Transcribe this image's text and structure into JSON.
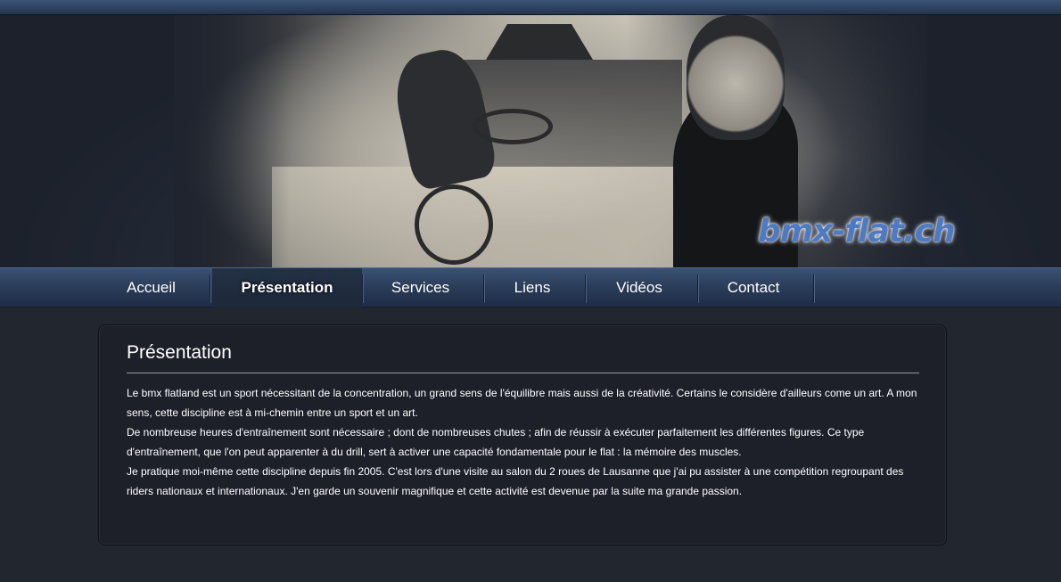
{
  "site": {
    "logo_text": "bmx-flat.ch"
  },
  "nav": {
    "items": [
      {
        "label": "Accueil",
        "active": false
      },
      {
        "label": "Présentation",
        "active": true
      },
      {
        "label": "Services",
        "active": false
      },
      {
        "label": "Liens",
        "active": false
      },
      {
        "label": "Vidéos",
        "active": false
      },
      {
        "label": "Contact",
        "active": false
      }
    ]
  },
  "content": {
    "title": "Présentation",
    "paragraphs": [
      "Le bmx flatland est un sport nécessitant de la concentration, un grand sens de l'équilibre mais aussi de la créativité. Certains le considère d'ailleurs come un art. A mon sens, cette discipline est à mi-chemin entre un sport et un art.",
      "De nombreuse heures d'entraînement sont nécessaire ; dont de nombreuses chutes ; afin de réussir à exécuter parfaitement les différentes figures. Ce type d'entraînement, que l'on peut apparenter à du drill, sert à activer une capacité fondamentale pour le flat : la mémoire des muscles.",
      "Je pratique moi-même cette discipline depuis fin 2005. C'est lors d'une visite au salon du 2 roues de Lausanne que j'ai pu assister à une compétition regroupant des riders nationaux et internationaux. J'en garde un souvenir magnifique et cette activité est devenue par la suite ma grande passion."
    ]
  },
  "colors": {
    "background": "#22262f",
    "nav_top": "#3b5273",
    "nav_bottom": "#1f2d45",
    "logo": "#4e7ac4"
  }
}
